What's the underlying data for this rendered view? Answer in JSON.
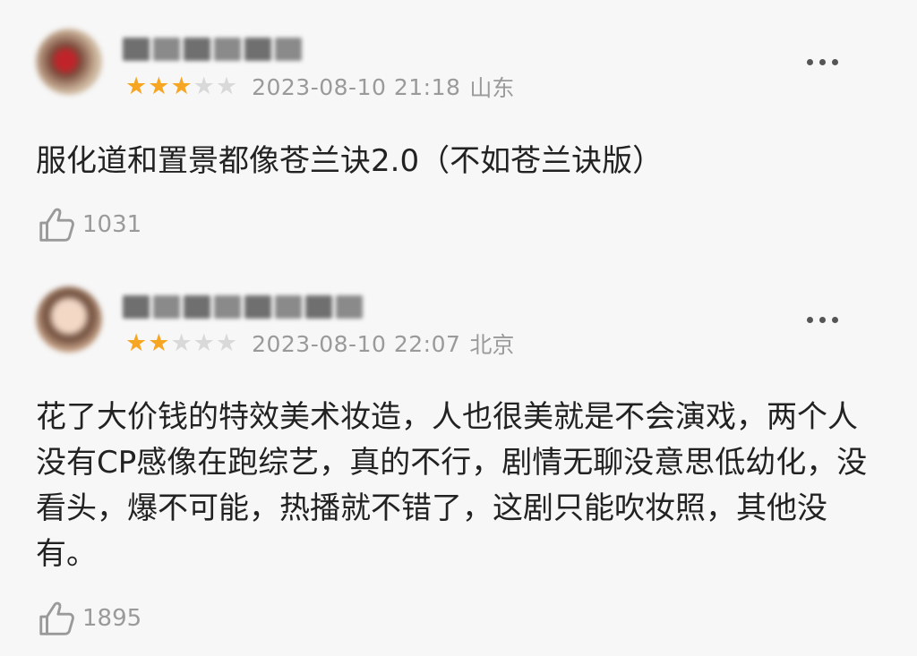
{
  "comments": [
    {
      "username": "",
      "rating": 3,
      "rating_max": 5,
      "date": "2023-08-10 21:18",
      "location": "山东",
      "text": "服化道和置景都像苍兰诀2.0（不如苍兰诀版）",
      "likes": "1031",
      "more_icon": "more-dots-icon",
      "like_icon": "thumbs-up-icon"
    },
    {
      "username": "",
      "rating": 2,
      "rating_max": 5,
      "date": "2023-08-10 22:07",
      "location": "北京",
      "text": "花了大价钱的特效美术妆造，人也很美就是不会演戏，两个人没有CP感像在跑综艺，真的不行，剧情无聊没意思低幼化，没看头，爆不可能，热播就不错了，这剧只能吹妆照，其他没有。",
      "likes": "1895",
      "more_icon": "more-dots-icon",
      "like_icon": "thumbs-up-icon"
    }
  ],
  "colors": {
    "star_on": "#f6a623",
    "star_off": "#d9d9d9",
    "meta_text": "#9a9a9a",
    "body_text": "#222222",
    "background": "#f7f7f7"
  }
}
